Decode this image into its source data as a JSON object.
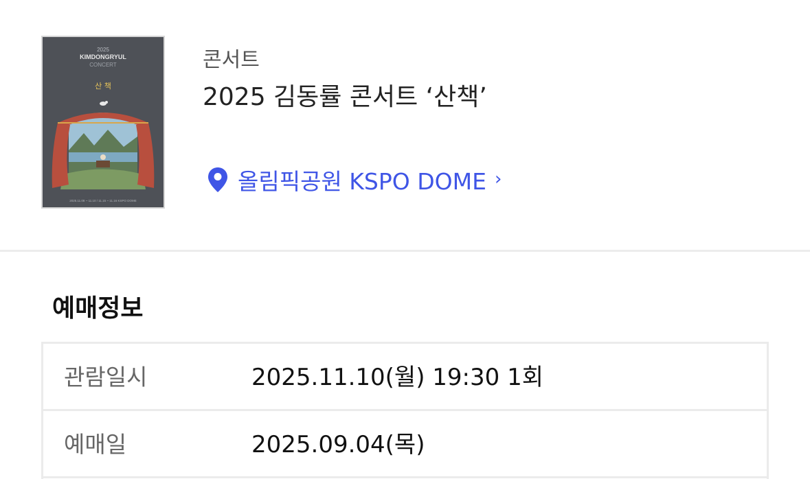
{
  "event": {
    "category": "콘서트",
    "title": "2025 김동률 콘서트 ‘산책’",
    "venue": "올림픽공원 KSPO DOME",
    "venue_icon": "map-pin-icon",
    "venue_chevron": "›",
    "accent_color": "#3f55e6",
    "poster": {
      "year": "2025",
      "artist": "KIMDONGRYUL",
      "subtitle": "CONCERT",
      "title": "산 책",
      "footer": "2025.11.08 ~ 11.10 / 11.15 ~ 11.16 KSPO DOME"
    }
  },
  "booking": {
    "section_title": "예매정보",
    "rows": [
      {
        "label": "관람일시",
        "value": "2025.11.10(월) 19:30 1회"
      },
      {
        "label": "예매일",
        "value": "2025.09.04(목)"
      }
    ]
  }
}
